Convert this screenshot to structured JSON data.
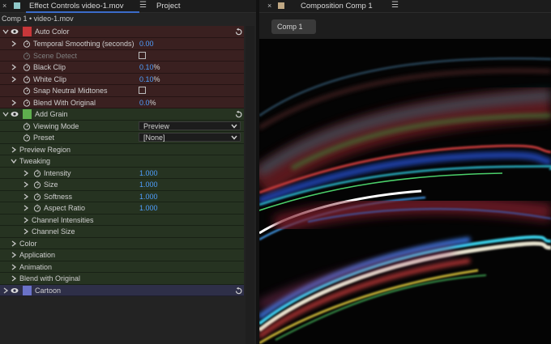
{
  "left_tabs": {
    "close": "×",
    "effect_controls_label": "Effect Controls video-1.mov",
    "menu": "☰",
    "project_label": "Project"
  },
  "breadcrumb": "Comp 1 • video-1.mov",
  "effects": {
    "auto_color": {
      "name": "Auto Color",
      "color": "#c8373a",
      "params": [
        {
          "label": "Temporal Smoothing (seconds)",
          "value": "0.00",
          "unit": ""
        },
        {
          "label": "Scene Detect",
          "checkbox": false
        },
        {
          "label": "Black Clip",
          "value": "0.10",
          "unit": "%"
        },
        {
          "label": "White Clip",
          "value": "0.10",
          "unit": "%"
        },
        {
          "label": "Snap Neutral Midtones",
          "checkbox": false
        },
        {
          "label": "Blend With Original",
          "value": "0.0",
          "unit": "%"
        }
      ]
    },
    "add_grain": {
      "name": "Add Grain",
      "color": "#5fae4e",
      "viewing_mode_label": "Viewing Mode",
      "viewing_mode_value": "Preview",
      "preset_label": "Preset",
      "preset_value": "[None]",
      "preview_region": "Preview Region",
      "tweaking": "Tweaking",
      "tweak_params": [
        {
          "label": "Intensity",
          "value": "1.000"
        },
        {
          "label": "Size",
          "value": "1.000"
        },
        {
          "label": "Softness",
          "value": "1.000"
        },
        {
          "label": "Aspect Ratio",
          "value": "1.000"
        }
      ],
      "channel_intensities": "Channel Intensities",
      "channel_size": "Channel Size",
      "color_group": "Color",
      "application": "Application",
      "animation": "Animation",
      "blend_with_original": "Blend with Original"
    },
    "cartoon": {
      "name": "Cartoon",
      "color": "#6a72c8"
    }
  },
  "right_tabs": {
    "close": "×",
    "composition_label": "Composition Comp 1",
    "menu": "☰",
    "swatch_color": "#bfa783"
  },
  "comp_chip": "Comp 1",
  "accent_value_color": "#4f9fff"
}
